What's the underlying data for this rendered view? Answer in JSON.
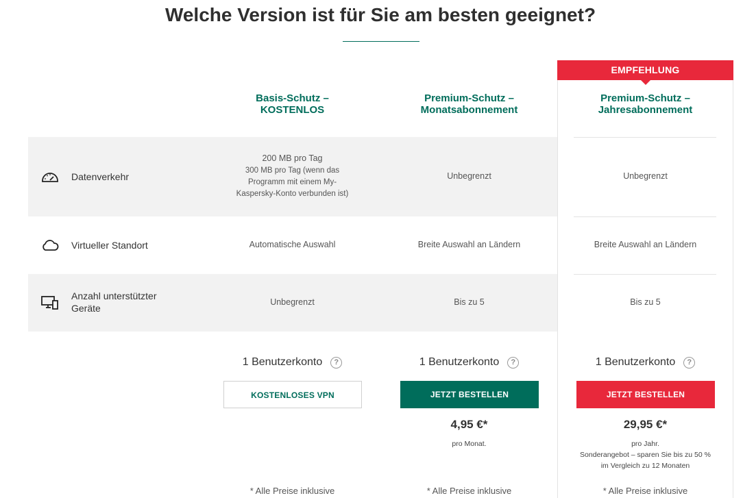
{
  "header": {
    "title": "Welche Version ist für Sie am besten geeignet?"
  },
  "badge": {
    "label": "EMPFEHLUNG"
  },
  "plans": [
    {
      "name": "Basis-Schutz –\nKOSTENLOS"
    },
    {
      "name": "Premium-Schutz –\nMonatsabonnement"
    },
    {
      "name": "Premium-Schutz –\nJahresabonnement"
    }
  ],
  "features": [
    {
      "icon": "speedometer-icon",
      "label": "Datenverkehr",
      "values": [
        {
          "main": "200 MB pro Tag",
          "sub": "300 MB pro Tag (wenn das Programm mit einem My-Kaspersky-Konto verbunden ist)"
        },
        {
          "main": "Unbegrenzt"
        },
        {
          "main": "Unbegrenzt"
        }
      ]
    },
    {
      "icon": "cloud-icon",
      "label": "Virtueller Standort",
      "values": [
        {
          "main": "Automatische Auswahl"
        },
        {
          "main": "Breite Auswahl an Ländern"
        },
        {
          "main": "Breite Auswahl an Ländern"
        }
      ]
    },
    {
      "icon": "devices-icon",
      "label": "Anzahl unterstützter Geräte",
      "values": [
        {
          "main": "Unbegrenzt"
        },
        {
          "main": "Bis zu 5"
        },
        {
          "main": "Bis zu 5"
        }
      ]
    }
  ],
  "accounts": [
    {
      "label": "1 Benutzerkonto",
      "help": "?"
    },
    {
      "label": "1 Benutzerkonto",
      "help": "?"
    },
    {
      "label": "1 Benutzerkonto",
      "help": "?"
    }
  ],
  "buttons": [
    {
      "label": "KOSTENLOSES VPN"
    },
    {
      "label": "JETZT BESTELLEN"
    },
    {
      "label": "JETZT BESTELLEN"
    }
  ],
  "pricing": [
    null,
    {
      "price": "4,95 €*",
      "period": "pro Monat."
    },
    {
      "price": "29,95 €*",
      "period": "pro Jahr.",
      "offer": "Sonderangebot – sparen Sie bis zu 50 % im Vergleich zu 12 Monaten"
    }
  ],
  "footnotes": [
    "* Alle Preise inklusive",
    "* Alle Preise inklusive",
    "* Alle Preise inklusive"
  ],
  "colors": {
    "brand_green": "#006d5b",
    "accent_red": "#e8283b",
    "band_gray": "#f2f2f2"
  }
}
